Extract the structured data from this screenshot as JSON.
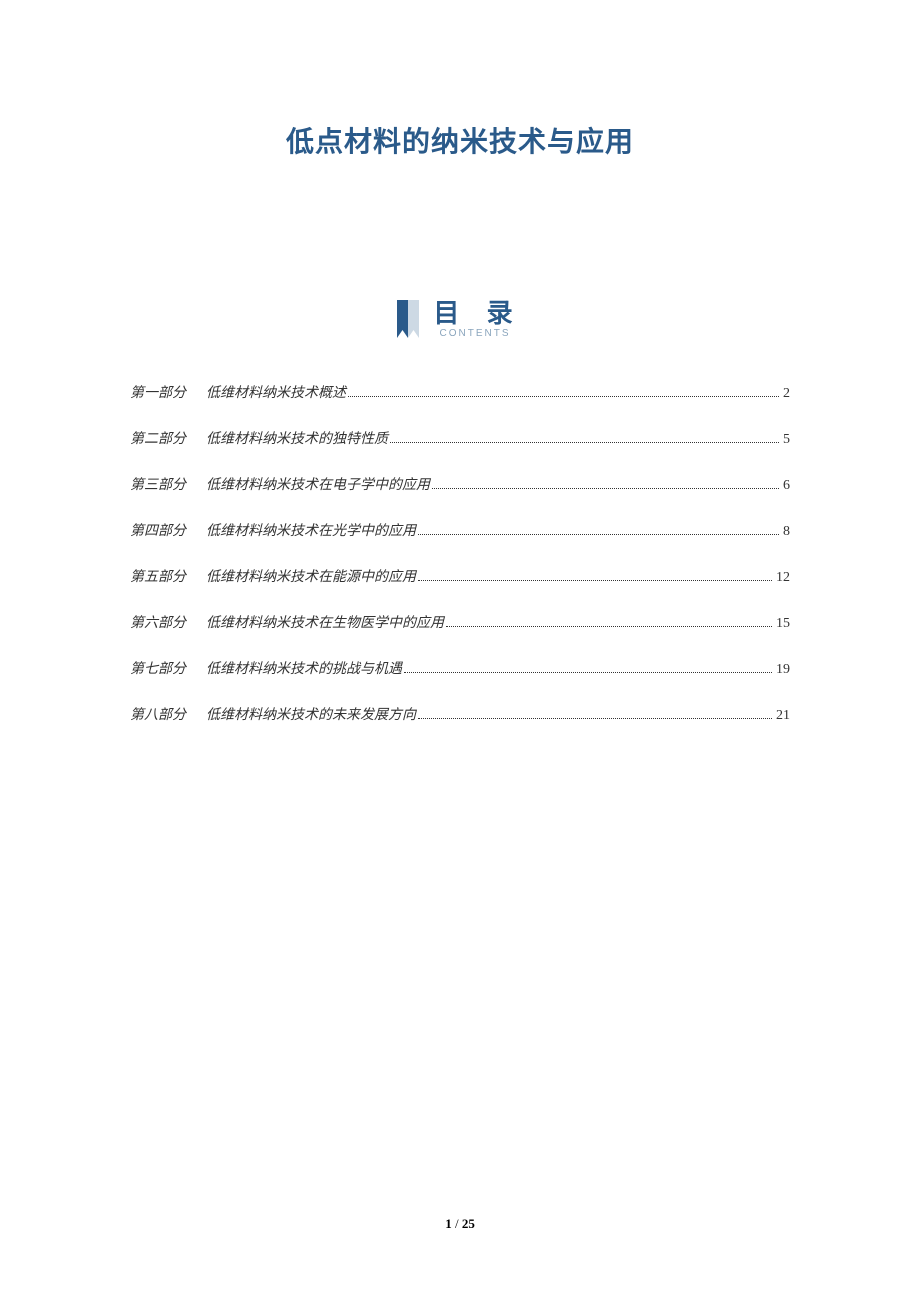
{
  "title": "低点材料的纳米技术与应用",
  "toc": {
    "heading": "目 录",
    "subheading": "CONTENTS",
    "items": [
      {
        "part": "第一部分",
        "name": "低维材料纳米技术概述",
        "page": "2"
      },
      {
        "part": "第二部分",
        "name": "低维材料纳米技术的独特性质",
        "page": "5"
      },
      {
        "part": "第三部分",
        "name": "低维材料纳米技术在电子学中的应用",
        "page": "6"
      },
      {
        "part": "第四部分",
        "name": "低维材料纳米技术在光学中的应用",
        "page": "8"
      },
      {
        "part": "第五部分",
        "name": "低维材料纳米技术在能源中的应用",
        "page": "12"
      },
      {
        "part": "第六部分",
        "name": "低维材料纳米技术在生物医学中的应用",
        "page": "15"
      },
      {
        "part": "第七部分",
        "name": "低维材料纳米技术的挑战与机遇",
        "page": "19"
      },
      {
        "part": "第八部分",
        "name": "低维材料纳米技术的未来发展方向",
        "page": "21"
      }
    ]
  },
  "footer": {
    "current": "1",
    "sep": " / ",
    "total": "25"
  }
}
